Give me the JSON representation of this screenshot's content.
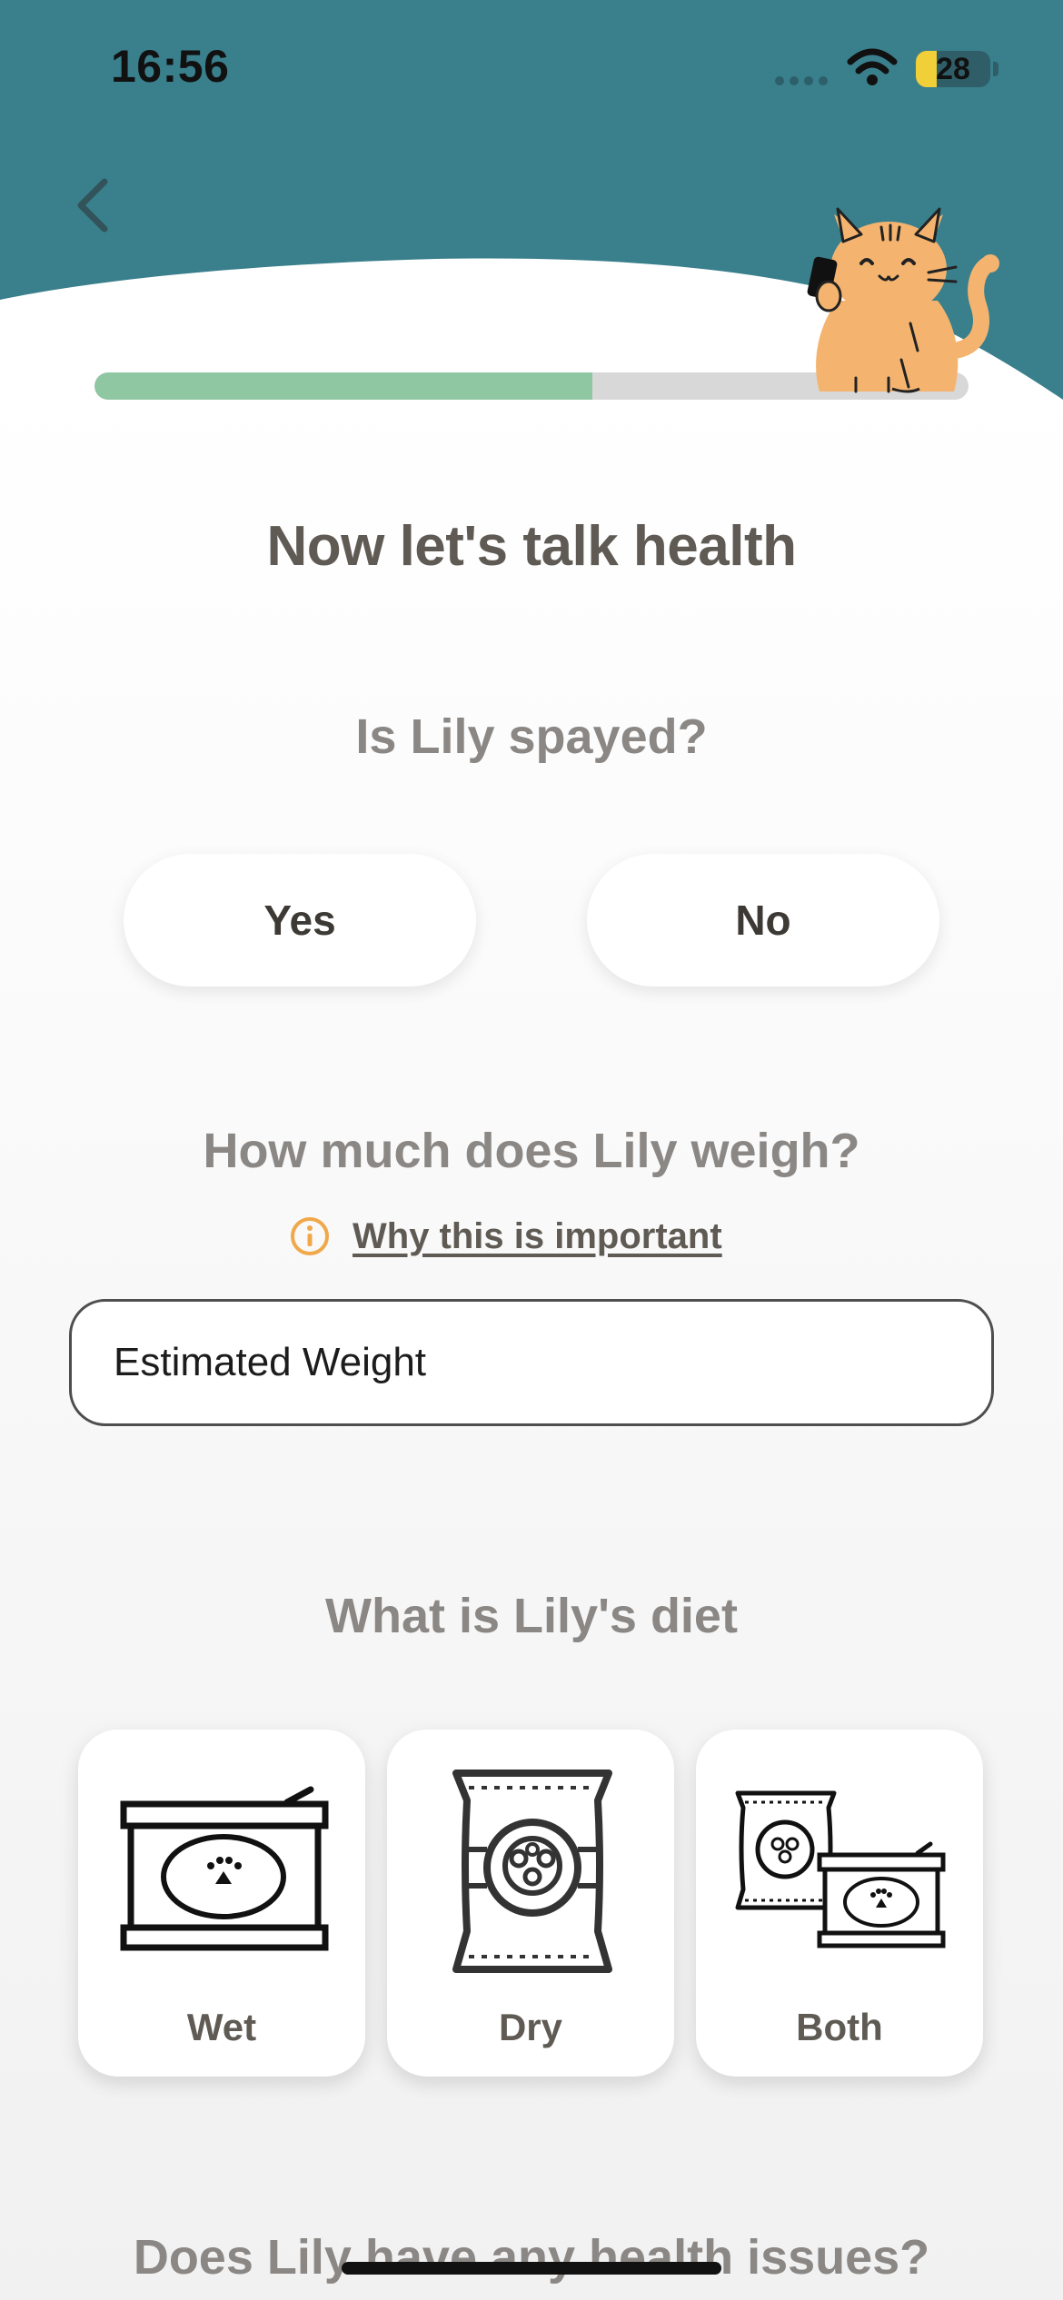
{
  "status_bar": {
    "time": "16:56",
    "battery_percent": 28,
    "battery_label": "28"
  },
  "header": {
    "back_icon": "chevron-left-icon",
    "mascot_icon": "cat-holding-phone-icon",
    "brand_color": "#3a7f8c",
    "progress": 0.57
  },
  "page": {
    "title": "Now let's talk health"
  },
  "spayed": {
    "question": "Is Lily spayed?",
    "yes_label": "Yes",
    "no_label": "No"
  },
  "weight": {
    "question": "How much does Lily weigh?",
    "info_icon": "info-circle-icon",
    "info_link": "Why this is important",
    "placeholder": "Estimated Weight",
    "value": ""
  },
  "diet": {
    "question": "What is Lily's diet",
    "options": [
      {
        "label": "Wet",
        "icon": "wet-food-can-icon"
      },
      {
        "label": "Dry",
        "icon": "dry-food-bag-icon"
      },
      {
        "label": "Both",
        "icon": "wet-and-dry-food-icon"
      }
    ]
  },
  "next_section": {
    "question": "Does Lily have any health issues?"
  }
}
